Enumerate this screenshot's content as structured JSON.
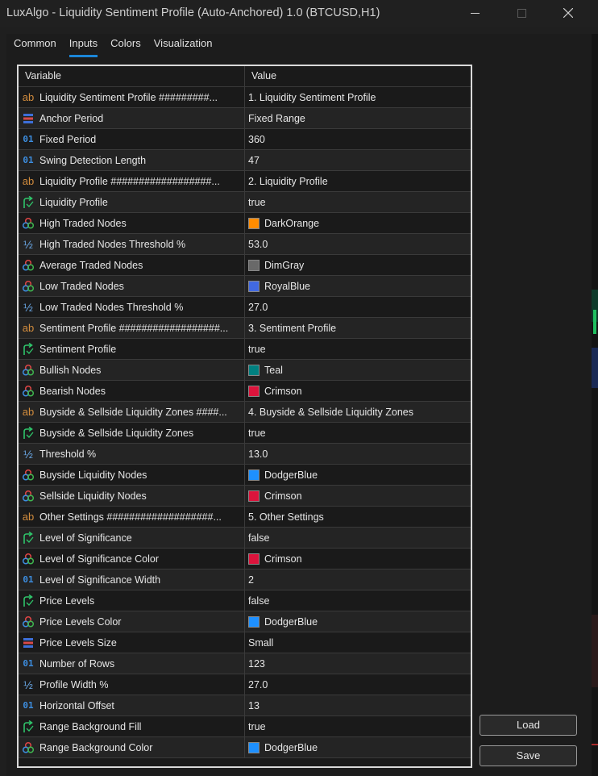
{
  "window": {
    "title": "LuxAlgo - Liquidity Sentiment Profile (Auto-Anchored) 1.0 (BTCUSD,H1)"
  },
  "tabs": [
    {
      "label": "Common",
      "active": false
    },
    {
      "label": "Inputs",
      "active": true
    },
    {
      "label": "Colors",
      "active": false
    },
    {
      "label": "Visualization",
      "active": false
    }
  ],
  "grid": {
    "col_variable": "Variable",
    "col_value": "Value",
    "rows": [
      {
        "icon": "ab",
        "variable": "Liquidity Sentiment Profile #########...",
        "value": "1. Liquidity Sentiment Profile"
      },
      {
        "icon": "list",
        "variable": "Anchor Period",
        "value": "Fixed Range"
      },
      {
        "icon": "int",
        "variable": "Fixed Period",
        "value": "360"
      },
      {
        "icon": "int",
        "variable": "Swing Detection Length",
        "value": "47"
      },
      {
        "icon": "ab",
        "variable": "Liquidity Profile ##################...",
        "value": "2. Liquidity Profile"
      },
      {
        "icon": "bool",
        "variable": "Liquidity Profile",
        "value": "true"
      },
      {
        "icon": "color",
        "variable": "High Traded Nodes",
        "value": "DarkOrange",
        "swatch": "#ff8c00"
      },
      {
        "icon": "double",
        "variable": "High Traded Nodes Threshold %",
        "value": "53.0"
      },
      {
        "icon": "color",
        "variable": "Average Traded Nodes",
        "value": "DimGray",
        "swatch": "#696969"
      },
      {
        "icon": "color",
        "variable": "Low Traded Nodes",
        "value": "RoyalBlue",
        "swatch": "#4169e1"
      },
      {
        "icon": "double",
        "variable": "Low Traded Nodes Threshold %",
        "value": "27.0"
      },
      {
        "icon": "ab",
        "variable": "Sentiment Profile ##################...",
        "value": "3. Sentiment Profile"
      },
      {
        "icon": "bool",
        "variable": "Sentiment Profile",
        "value": "true"
      },
      {
        "icon": "color",
        "variable": "Bullish Nodes",
        "value": "Teal",
        "swatch": "#008080"
      },
      {
        "icon": "color",
        "variable": "Bearish Nodes",
        "value": "Crimson",
        "swatch": "#dc143c"
      },
      {
        "icon": "ab",
        "variable": "Buyside & Sellside Liquidity Zones ####...",
        "value": "4. Buyside & Sellside Liquidity Zones"
      },
      {
        "icon": "bool",
        "variable": "Buyside & Sellside Liquidity Zones",
        "value": "true"
      },
      {
        "icon": "double",
        "variable": "Threshold %",
        "value": "13.0"
      },
      {
        "icon": "color",
        "variable": "Buyside Liquidity Nodes",
        "value": "DodgerBlue",
        "swatch": "#1e90ff"
      },
      {
        "icon": "color",
        "variable": "Sellside Liquidity Nodes",
        "value": "Crimson",
        "swatch": "#dc143c"
      },
      {
        "icon": "ab",
        "variable": "Other Settings ###################...",
        "value": "5. Other Settings"
      },
      {
        "icon": "bool",
        "variable": "Level of Significance",
        "value": "false"
      },
      {
        "icon": "color",
        "variable": "Level of Significance Color",
        "value": "Crimson",
        "swatch": "#dc143c"
      },
      {
        "icon": "int",
        "variable": "Level of Significance Width",
        "value": "2"
      },
      {
        "icon": "bool",
        "variable": "Price Levels",
        "value": "false"
      },
      {
        "icon": "color",
        "variable": "Price Levels Color",
        "value": "DodgerBlue",
        "swatch": "#1e90ff"
      },
      {
        "icon": "list",
        "variable": "Price Levels Size",
        "value": "Small"
      },
      {
        "icon": "int",
        "variable": "Number of Rows",
        "value": "123"
      },
      {
        "icon": "double",
        "variable": "Profile Width %",
        "value": "27.0"
      },
      {
        "icon": "int",
        "variable": "Horizontal Offset",
        "value": "13"
      },
      {
        "icon": "bool",
        "variable": "Range Background Fill",
        "value": "true"
      },
      {
        "icon": "color",
        "variable": "Range Background Color",
        "value": "DodgerBlue",
        "swatch": "#1e90ff"
      }
    ]
  },
  "buttons": {
    "load": "Load",
    "save": "Save"
  },
  "icons": {
    "ab": "string-icon",
    "int": "integer-icon",
    "double": "double-icon",
    "bool": "bool-icon",
    "color": "color-icon",
    "list": "enum-icon"
  },
  "colors": {
    "tab_underline": "#1b86d8"
  }
}
